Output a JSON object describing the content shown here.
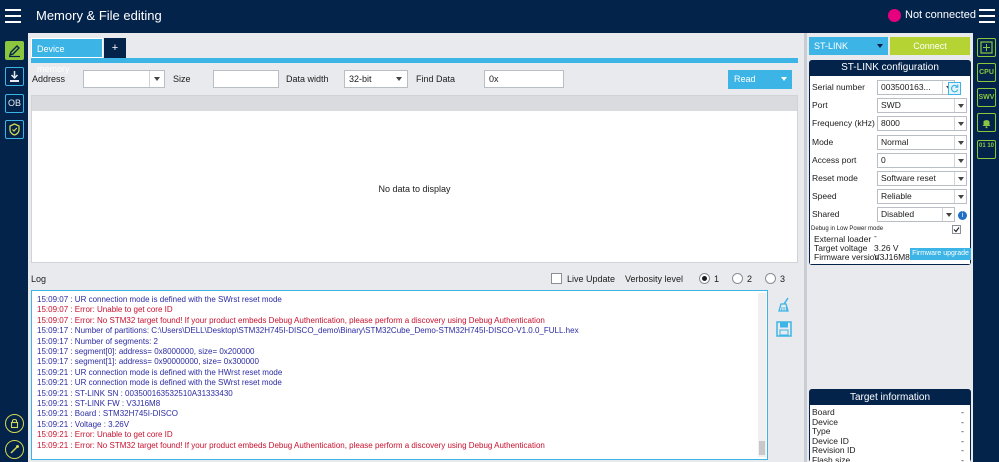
{
  "header": {
    "title": "Memory & File editing",
    "connection_status": "Not connected"
  },
  "left_toolbar": [
    {
      "icon": "edit-icon",
      "active": true
    },
    {
      "icon": "download-icon",
      "active": false
    },
    {
      "icon": "ob-icon",
      "label": "OB",
      "active": false
    },
    {
      "icon": "shield-icon",
      "active": false
    },
    {
      "icon": "security-icon",
      "active": false
    },
    {
      "icon": "probe-icon",
      "active": false
    }
  ],
  "tabs": [
    {
      "label": "Device memory"
    }
  ],
  "tab_add_label": "+",
  "memory": {
    "address_label": "Address",
    "address_value": "",
    "size_label": "Size",
    "size_value": "",
    "data_width_label": "Data width",
    "data_width_value": "32-bit",
    "find_label": "Find Data",
    "find_value": "0x",
    "read_label": "Read",
    "empty_text": "No data to display"
  },
  "log": {
    "title": "Log",
    "live_update_label": "Live Update",
    "verbosity_label": "Verbosity level",
    "levels": [
      "1",
      "2",
      "3"
    ],
    "selected_level": "1",
    "lines": [
      {
        "text": "15:09:07 : UR connection mode is defined with the SWrst reset mode",
        "type": "info"
      },
      {
        "text": "15:09:07 : Error: Unable to get core ID",
        "type": "err"
      },
      {
        "text": "15:09:07 : Error: No STM32 target found! If your product embeds Debug Authentication, please perform a discovery using Debug Authentication",
        "type": "err"
      },
      {
        "text": "15:09:17 : Number of partitions: C:\\Users\\DELL\\Desktop\\STM32H745I-DISCO_demo\\Binary\\STM32Cube_Demo-STM32H745I-DISCO-V1.0.0_FULL.hex",
        "type": "info"
      },
      {
        "text": "15:09:17 : Number of segments: 2",
        "type": "info"
      },
      {
        "text": "15:09:17 : segment[0]: address= 0x8000000, size= 0x200000",
        "type": "info"
      },
      {
        "text": "15:09:17 : segment[1]: address= 0x90000000, size= 0x300000",
        "type": "info"
      },
      {
        "text": "15:09:21 : UR connection mode is defined with the HWrst reset mode",
        "type": "info"
      },
      {
        "text": "15:09:21 : UR connection mode is defined with the SWrst reset mode",
        "type": "info"
      },
      {
        "text": "15:09:21 : ST-LINK SN  : 003500163532510A31333430",
        "type": "info"
      },
      {
        "text": "15:09:21 : ST-LINK FW  : V3J16M8",
        "type": "info"
      },
      {
        "text": "15:09:21 : Board       : STM32H745I-DISCO",
        "type": "info"
      },
      {
        "text": "15:09:21 : Voltage     : 3.26V",
        "type": "info"
      },
      {
        "text": "15:09:21 : Error: Unable to get core ID",
        "type": "err"
      },
      {
        "text": "15:09:21 : Error: No STM32 target found! If your product embeds Debug Authentication, please perform a discovery using Debug Authentication",
        "type": "err"
      }
    ]
  },
  "probe": {
    "interface": "ST-LINK",
    "connect_label": "Connect",
    "config_title": "ST-LINK configuration",
    "fields": [
      {
        "label": "Serial number",
        "value": "003500163..."
      },
      {
        "label": "Port",
        "value": "SWD"
      },
      {
        "label": "Frequency (kHz)",
        "value": "8000"
      },
      {
        "label": "Mode",
        "value": "Normal"
      },
      {
        "label": "Access port",
        "value": "0"
      },
      {
        "label": "Reset mode",
        "value": "Software reset"
      },
      {
        "label": "Speed",
        "value": "Reliable"
      },
      {
        "label": "Shared",
        "value": "Disabled"
      }
    ],
    "debug_low_power_label": "Debug in Low Power mode",
    "external_loader_label": "External loader",
    "external_loader_value": "-",
    "target_voltage_label": "Target voltage",
    "target_voltage_value": "3.26 V",
    "firmware_version_label": "Firmware version",
    "firmware_version_value": "V3J16M8",
    "firmware_upgrade_label": "Firmware upgrade"
  },
  "target_info": {
    "title": "Target information",
    "rows": [
      {
        "label": "Board",
        "value": "-"
      },
      {
        "label": "Device",
        "value": "-"
      },
      {
        "label": "Type",
        "value": "-"
      },
      {
        "label": "Device ID",
        "value": "-"
      },
      {
        "label": "Revision ID",
        "value": "-"
      },
      {
        "label": "Flash size",
        "value": "-"
      }
    ]
  },
  "right_toolbar": [
    {
      "icon": "swv-icon",
      "label": ""
    },
    {
      "icon": "cpu-icon",
      "label": "CPU"
    },
    {
      "icon": "swv-icon",
      "label": "SWV"
    },
    {
      "icon": "bell-icon",
      "label": ""
    },
    {
      "icon": "binary-icon",
      "label": "01 10"
    }
  ]
}
